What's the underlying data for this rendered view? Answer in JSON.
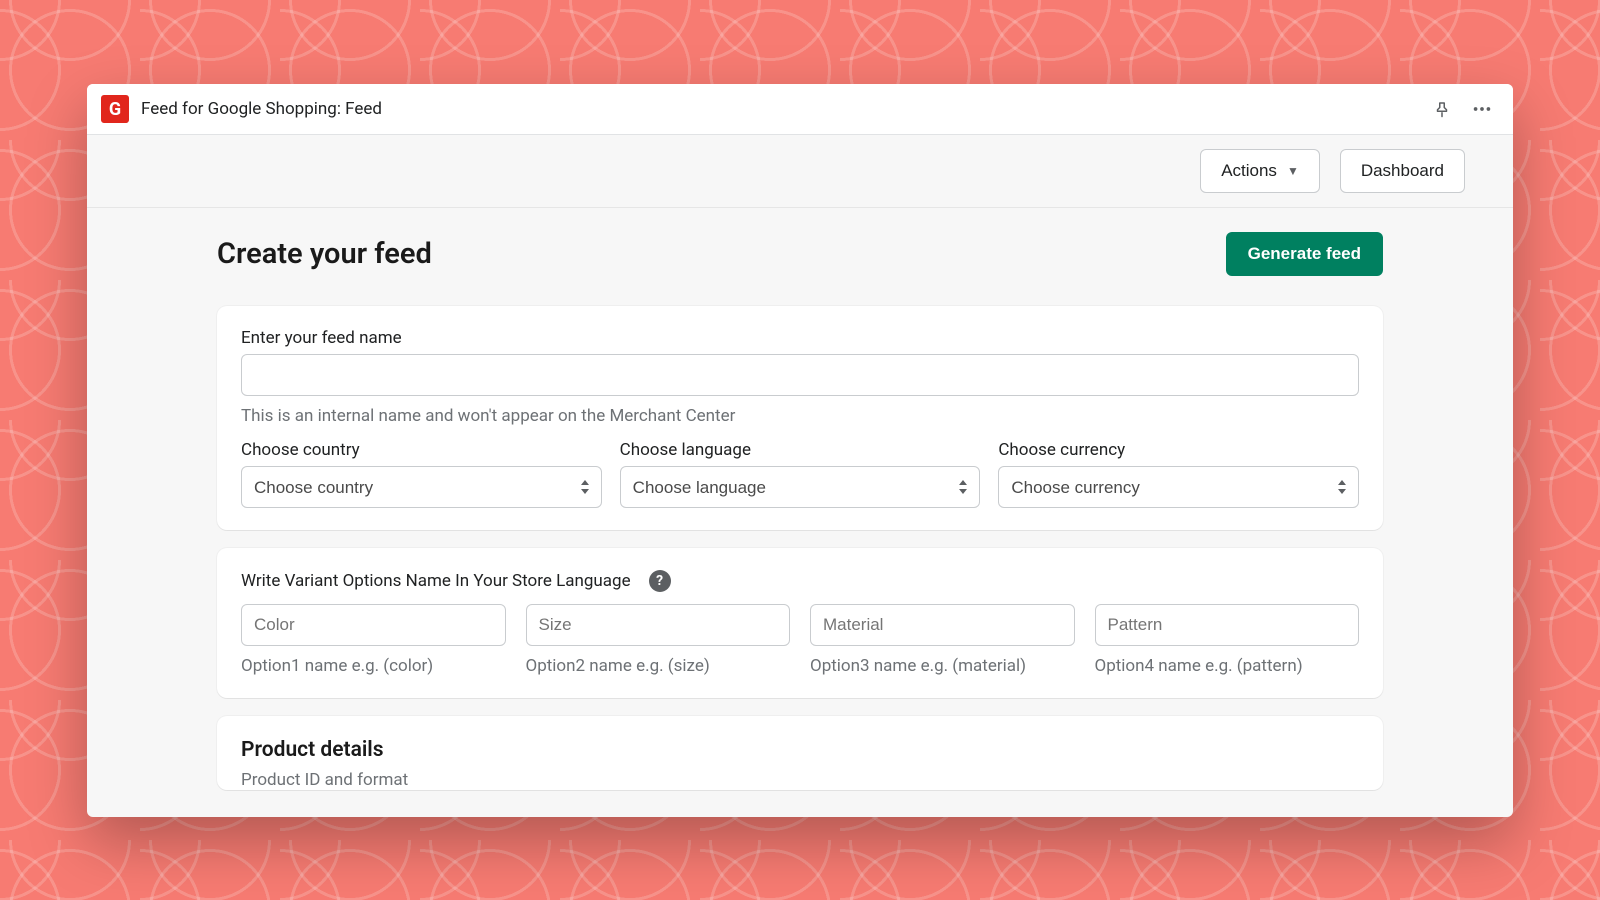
{
  "titlebar": {
    "app_glyph": "G",
    "title": "Feed for Google Shopping: Feed"
  },
  "toolbar": {
    "actions_label": "Actions",
    "dashboard_label": "Dashboard"
  },
  "page": {
    "heading": "Create your feed",
    "generate_label": "Generate feed"
  },
  "feed_name": {
    "label": "Enter your feed name",
    "value": "",
    "helper": "This is an internal name and won't appear on the Merchant Center"
  },
  "selects": {
    "country": {
      "label": "Choose country",
      "value": "Choose country"
    },
    "language": {
      "label": "Choose language",
      "value": "Choose language"
    },
    "currency": {
      "label": "Choose currency",
      "value": "Choose currency"
    }
  },
  "variant": {
    "heading": "Write Variant Options Name In Your Store Language",
    "options": [
      {
        "placeholder": "Color",
        "hint": "Option1 name e.g. (color)"
      },
      {
        "placeholder": "Size",
        "hint": "Option2 name e.g. (size)"
      },
      {
        "placeholder": "Material",
        "hint": "Option3 name e.g. (material)"
      },
      {
        "placeholder": "Pattern",
        "hint": "Option4 name e.g. (pattern)"
      }
    ]
  },
  "product_details": {
    "title": "Product details",
    "subtitle": "Product ID and format"
  }
}
